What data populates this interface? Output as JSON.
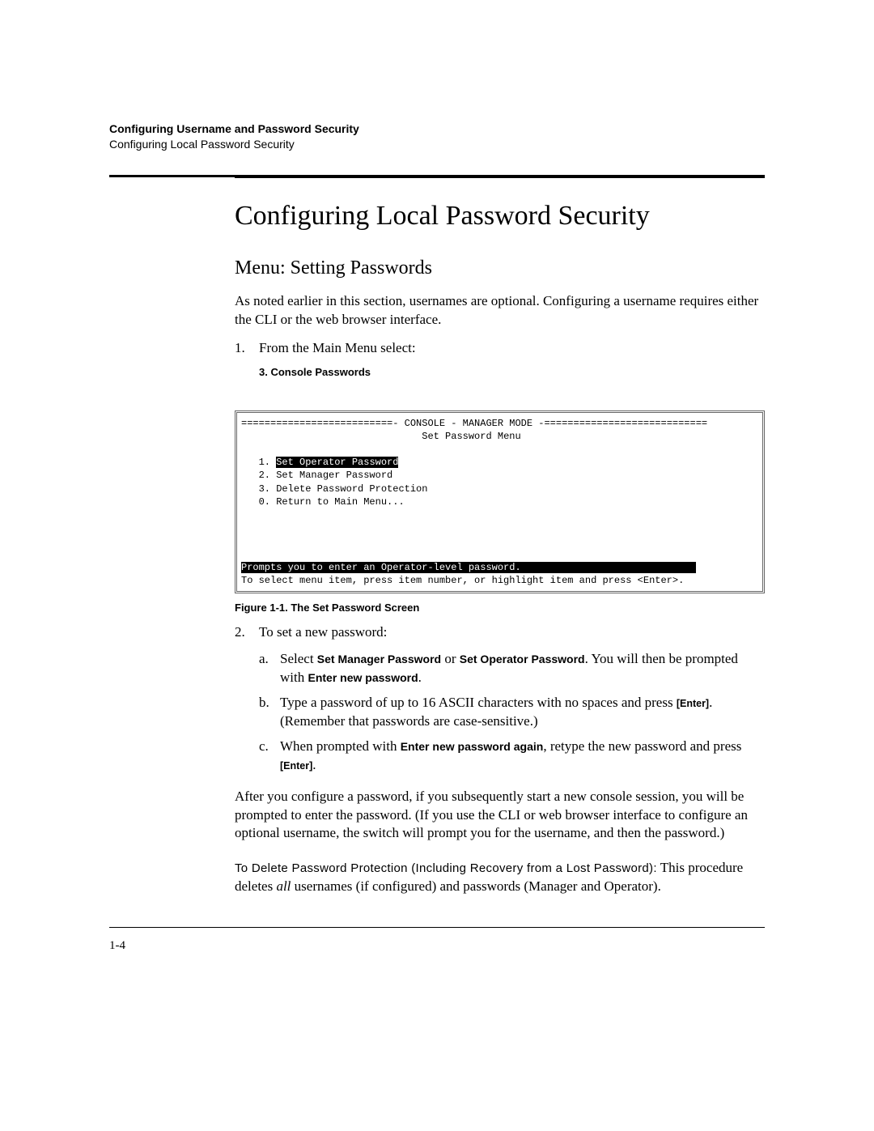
{
  "header": {
    "chapter": "Configuring Username and Password Security",
    "section": "Configuring Local Password Security"
  },
  "title": "Configuring Local Password Security",
  "subsection": "Menu: Setting Passwords",
  "intro": "As noted earlier in this section, usernames are optional. Configuring a user­name requires either the CLI or the web browser interface.",
  "step1": {
    "num": "1.",
    "text": "From the Main Menu select:",
    "menuPath": "3. Console Passwords"
  },
  "console": {
    "bar_left": "==========================- ",
    "mode": "CONSOLE - MANAGER MODE",
    "bar_right": " -============================",
    "menu_title": "Set Password Menu",
    "item1_num": "1. ",
    "item1_label": "Set Operator Password",
    "item2": "2. Set Manager Password",
    "item3": "3. Delete Password Protection",
    "item0": "0. Return to Main Menu...",
    "prompt_line": "Prompts you to enter an Operator-level password.                              ",
    "help_line": "To select menu item, press item number, or highlight item and press <Enter>."
  },
  "figure_caption": "Figure 1-1.  The Set Password Screen",
  "step2": {
    "num": "2.",
    "text": "To set a new password:",
    "a": {
      "num": "a.",
      "pre": "Select ",
      "b1": "Set Manager Password",
      "mid": " or ",
      "b2": "Set Operator Password",
      "post1": ". You will then be prompted with ",
      "b3": "Enter new password",
      "post2": "."
    },
    "b": {
      "num": "b.",
      "pre": "Type a password of up to 16 ASCII characters with no spaces and press ",
      "key": "[Enter]",
      "post": ". (Remember that passwords are case-sensitive.)"
    },
    "c": {
      "num": "c.",
      "pre": "When prompted with ",
      "b1": "Enter new password again",
      "mid": ", retype the new pass­word and press ",
      "key": "[Enter]",
      "post": "."
    }
  },
  "after": "After you configure a password, if you subsequently start a new console session, you will be prompted to enter the password. (If you use the CLI or web browser interface to configure an optional username, the switch will prompt you for the username, and then the password.)",
  "delete": {
    "heading": "To Delete Password Protection (Including Recovery from a Lost Password):",
    "pre": "  This procedure deletes ",
    "ital": "all",
    "post": " usernames (if configured) and pass­words (Manager and Operator)."
  },
  "page_number": "1-4"
}
